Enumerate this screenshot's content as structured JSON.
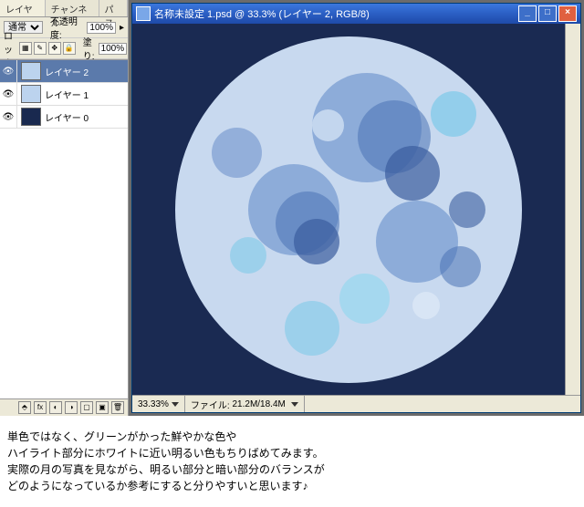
{
  "panel": {
    "tabs": [
      "レイヤー",
      "チャンネル",
      "パス"
    ],
    "blend_mode": "通常",
    "opacity_label": "不透明度:",
    "opacity_value": "100%",
    "lock_label": "ロック:",
    "fill_label": "塗り:",
    "fill_value": "100%",
    "layers": [
      {
        "name": "レイヤー 2",
        "thumb_color": "#bcd3ee",
        "selected": true
      },
      {
        "name": "レイヤー 1",
        "thumb_color": "#bcd3ee",
        "selected": false
      },
      {
        "name": "レイヤー 0",
        "thumb_color": "#19294f",
        "selected": false
      }
    ]
  },
  "document": {
    "title": "名称未設定 1.psd @ 33.3% (レイヤー 2, RGB/8)",
    "zoom": "33.33%",
    "filesize_label": "ファイル:",
    "filesize": "21.2M/18.4M"
  },
  "caption": {
    "line1": "単色ではなく、グリーンがかった鮮やかな色や",
    "line2": "ハイライト部分にホワイトに近い明るい色もちりばめてみます。",
    "line3": "実際の月の写真を見ながら、明るい部分と暗い部分のバランスが",
    "line4": "どのようになっているか参考にすると分りやすいと思います♪"
  }
}
